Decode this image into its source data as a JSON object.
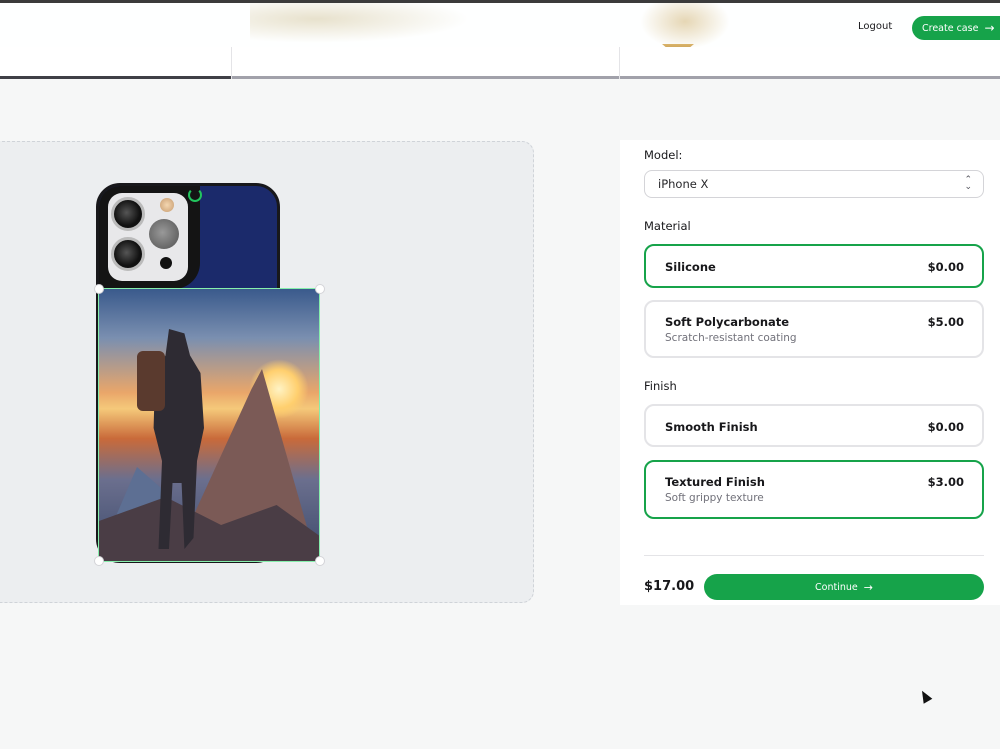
{
  "colors": {
    "accent": "#16a34a",
    "step_complete": "#3f3f46",
    "step_pending": "#a1a1aa",
    "case_color": "#1b2a6b"
  },
  "navbar": {
    "logout": "Logout",
    "create_case": "Create case",
    "create_case_icon": "arrow-right-icon"
  },
  "config": {
    "model_label": "Model:",
    "model_value": "iPhone X",
    "material_label": "Material",
    "materials": [
      {
        "name": "Silicone",
        "description": "",
        "price": "$0.00",
        "selected": true
      },
      {
        "name": "Soft Polycarbonate",
        "description": "Scratch-resistant coating",
        "price": "$5.00",
        "selected": false
      }
    ],
    "finish_label": "Finish",
    "finishes": [
      {
        "name": "Smooth Finish",
        "description": "",
        "price": "$0.00",
        "selected": false
      },
      {
        "name": "Textured Finish",
        "description": "Soft grippy texture",
        "price": "$3.00",
        "selected": true
      }
    ],
    "total": "$17.00",
    "continue_label": "Continue",
    "continue_icon": "arrow-right-icon"
  }
}
